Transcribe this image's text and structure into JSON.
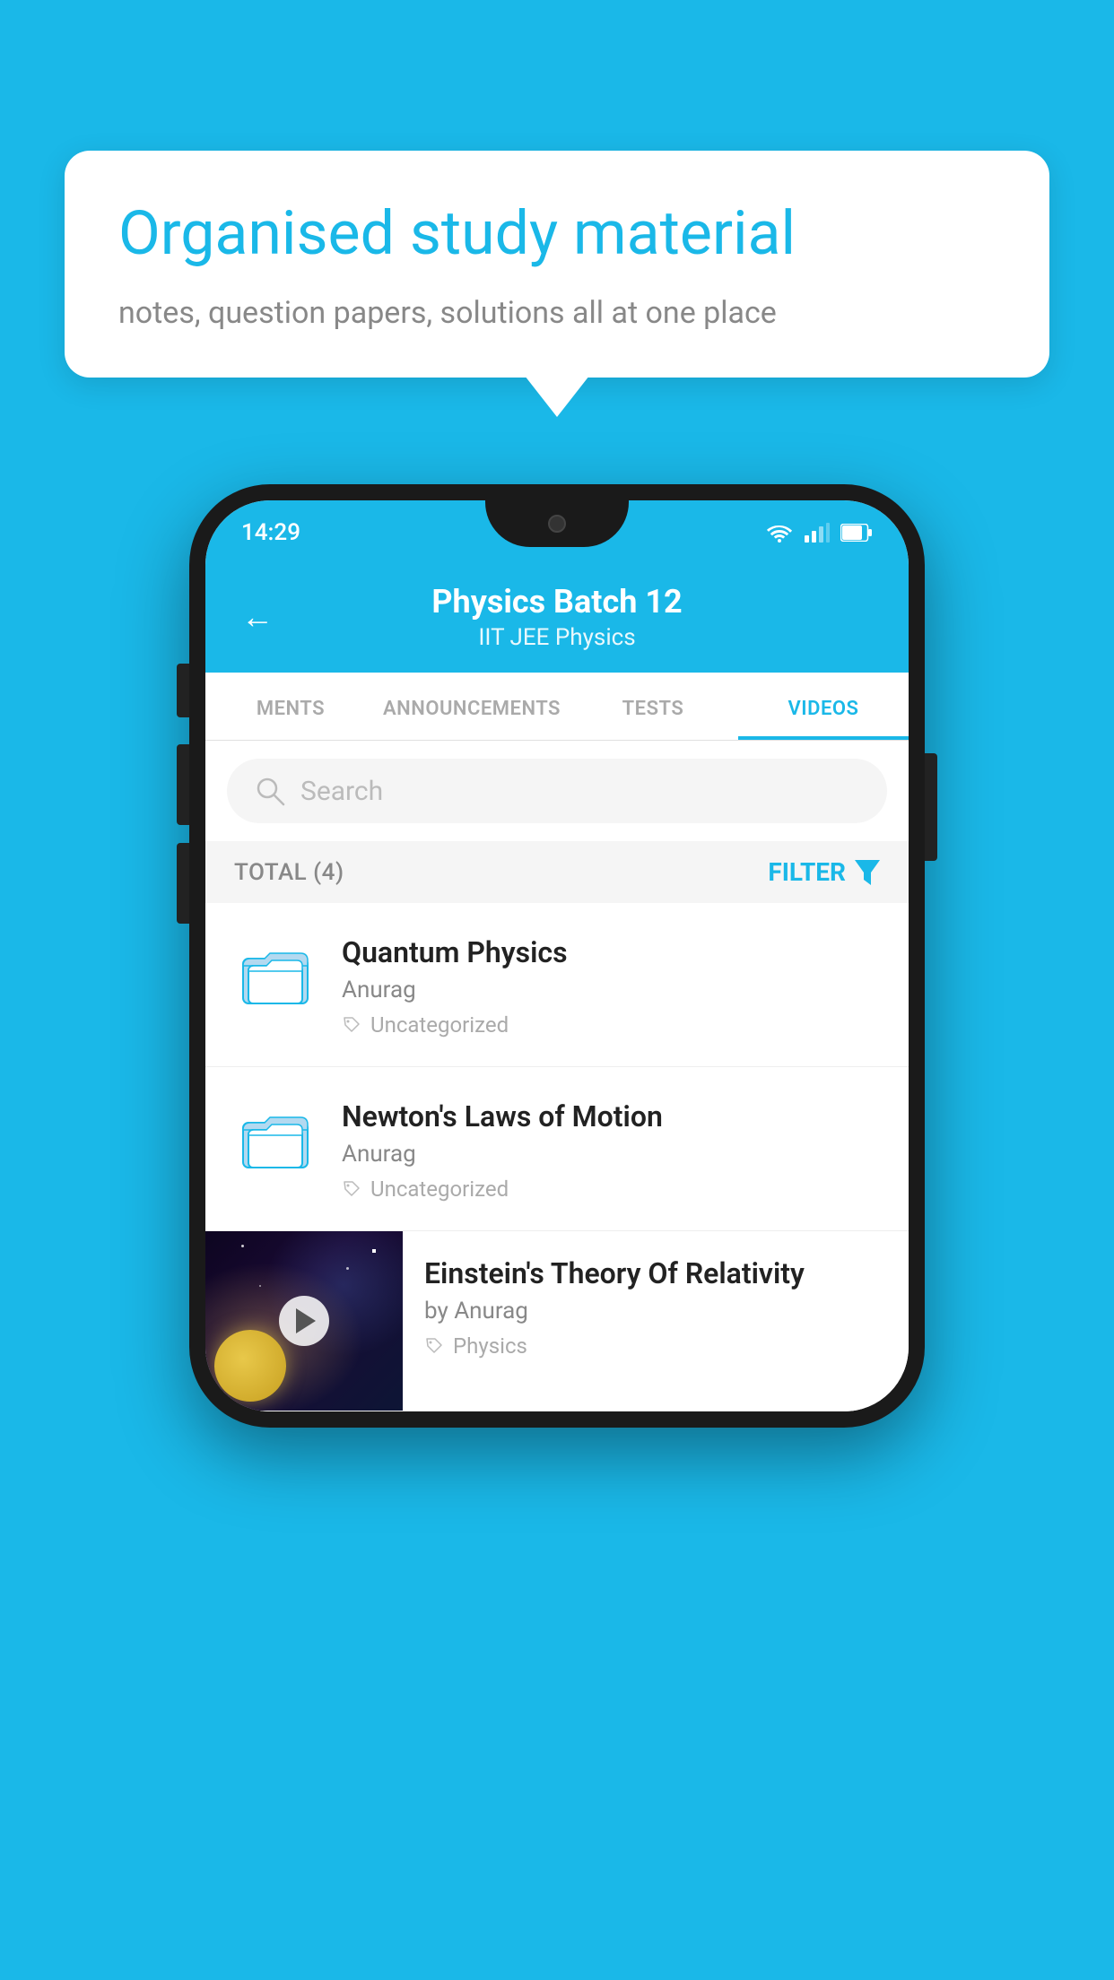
{
  "background_color": "#1ab8e8",
  "speech_bubble": {
    "title": "Organised study material",
    "subtitle": "notes, question papers, solutions all at one place"
  },
  "phone": {
    "status_bar": {
      "time": "14:29"
    },
    "header": {
      "title": "Physics Batch 12",
      "subtitle": "IIT JEE   Physics",
      "back_label": "←"
    },
    "tabs": [
      {
        "label": "MENTS",
        "active": false
      },
      {
        "label": "ANNOUNCEMENTS",
        "active": false
      },
      {
        "label": "TESTS",
        "active": false
      },
      {
        "label": "VIDEOS",
        "active": true
      }
    ],
    "search": {
      "placeholder": "Search"
    },
    "filter_row": {
      "total_label": "TOTAL (4)",
      "filter_label": "FILTER"
    },
    "videos": [
      {
        "id": 1,
        "title": "Quantum Physics",
        "author": "Anurag",
        "tag": "Uncategorized",
        "type": "folder"
      },
      {
        "id": 2,
        "title": "Newton's Laws of Motion",
        "author": "Anurag",
        "tag": "Uncategorized",
        "type": "folder"
      },
      {
        "id": 3,
        "title": "Einstein's Theory Of Relativity",
        "author": "by Anurag",
        "tag": "Physics",
        "type": "video"
      }
    ]
  }
}
